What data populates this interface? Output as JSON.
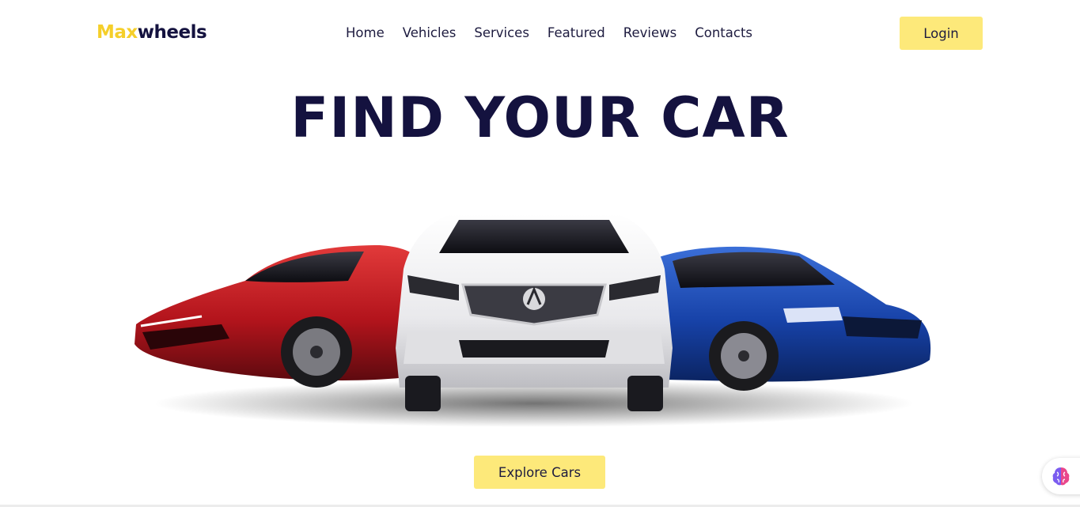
{
  "brand": {
    "accent": "Max",
    "rest": "wheels"
  },
  "nav": {
    "links": [
      "Home",
      "Vehicles",
      "Services",
      "Featured",
      "Reviews",
      "Contacts"
    ],
    "login_label": "Login"
  },
  "hero": {
    "title": "FIND YOUR CAR",
    "image": "three cars: red sports coupe, white SUV, blue sedan",
    "cta_label": "Explore Cars"
  },
  "assistant": {
    "icon": "brain-icon"
  },
  "colors": {
    "navy": "#14123f",
    "yellow_accent": "#f5cf2a",
    "button_yellow": "#fde97a"
  }
}
